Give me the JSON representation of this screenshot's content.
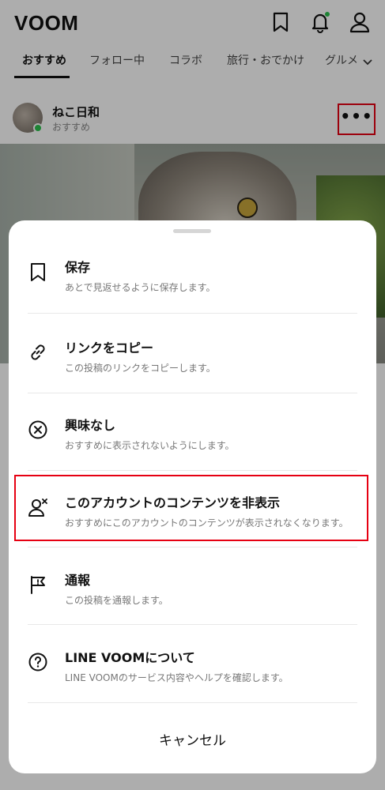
{
  "app": {
    "logo": "VOOM",
    "icons": [
      "bookmark-icon",
      "bell-icon",
      "profile-icon"
    ],
    "notification_dot_color": "#2cc24d"
  },
  "tabs": [
    {
      "label": "おすすめ",
      "active": true
    },
    {
      "label": "フォロー中",
      "active": false
    },
    {
      "label": "コラボ",
      "active": false
    },
    {
      "label": "旅行・おでかけ",
      "active": false
    },
    {
      "label": "グルメ",
      "active": false
    }
  ],
  "post": {
    "author": "ねこ日和",
    "subtitle": "おすすめ",
    "more_label": "•••"
  },
  "sheet": {
    "items": [
      {
        "title": "保存",
        "desc": "あとで見返せるように保存します。",
        "icon": "bookmark-icon"
      },
      {
        "title": "リンクをコピー",
        "desc": "この投稿のリンクをコピーします。",
        "icon": "link-icon"
      },
      {
        "title": "興味なし",
        "desc": "おすすめに表示されないようにします。",
        "icon": "close-circle-icon"
      },
      {
        "title": "このアカウントのコンテンツを非表示",
        "desc": "おすすめにこのアカウントのコンテンツが表示されなくなります。",
        "icon": "hide-account-icon",
        "highlighted": true
      },
      {
        "title": "通報",
        "desc": "この投稿を通報します。",
        "icon": "flag-icon"
      },
      {
        "title": "LINE VOOMについて",
        "desc": "LINE VOOMのサービス内容やヘルプを確認します。",
        "icon": "help-icon"
      }
    ],
    "cancel_label": "キャンセル"
  },
  "colors": {
    "highlight": "#e60012",
    "overlay": "rgba(0,0,0,0.32)"
  }
}
